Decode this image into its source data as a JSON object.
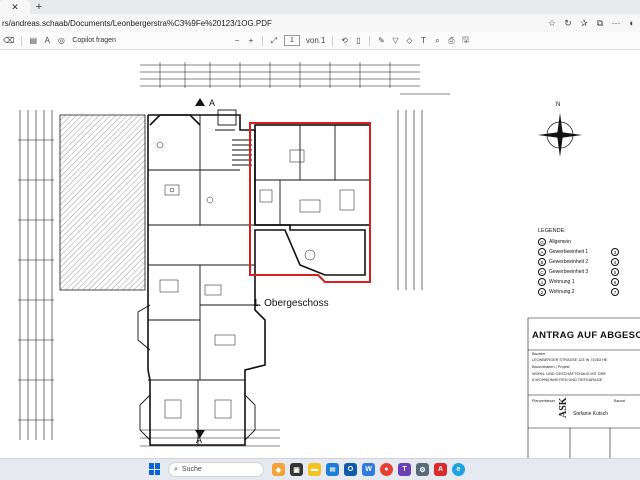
{
  "browser": {
    "url": "rs/andreas.schaab/Documents/Leonbergerstra%C3%9Fe%20123/1OG.PDF",
    "new_tab_label": "+"
  },
  "pdf_toolbar": {
    "copilot_label": "Copilot fragen",
    "page_number": "1",
    "page_total": "von 1",
    "zoom_out": "−",
    "zoom_in": "+"
  },
  "plan": {
    "floor_label": "1. Obergeschoss",
    "section_marker_top": "A",
    "section_marker_bottom": "A",
    "north_label": "N"
  },
  "legend": {
    "title": "LEGENDE:",
    "rows": [
      {
        "sym": "G",
        "label": "Allgemein",
        "right": ""
      },
      {
        "sym": "A",
        "label": "Gewerbeeinheit 1",
        "right": "3"
      },
      {
        "sym": "B",
        "label": "Gewerbeeinheit 2",
        "right": "4"
      },
      {
        "sym": "C",
        "label": "Gewerbeeinheit 3",
        "right": "5"
      },
      {
        "sym": "1",
        "label": "Wohnung 1",
        "right": "6"
      },
      {
        "sym": "2",
        "label": "Wohnung 2",
        "right": "7"
      }
    ]
  },
  "titleblock": {
    "title": "ANTRAG AUF ABGESCH",
    "row1_label": "Bauherr",
    "row2": "LEONBERGER STRASSE 123 IN 71083 HE",
    "row3_label": "Bauvorhaben / Projekt",
    "row4": "WOHN- UND GESCHÄFTSHAUS MIT DRE",
    "row5": "8 WOHNEINHEITEN UND TIEFGARAGE",
    "row6_label": "Planverfasser",
    "row7": "Stefanie Kutsch",
    "row8": "Bauort",
    "logo": "ASK"
  },
  "taskbar": {
    "search_label": "Suche"
  },
  "colors": {
    "highlight": "#d42020",
    "start_blue": "#0a66d2"
  }
}
